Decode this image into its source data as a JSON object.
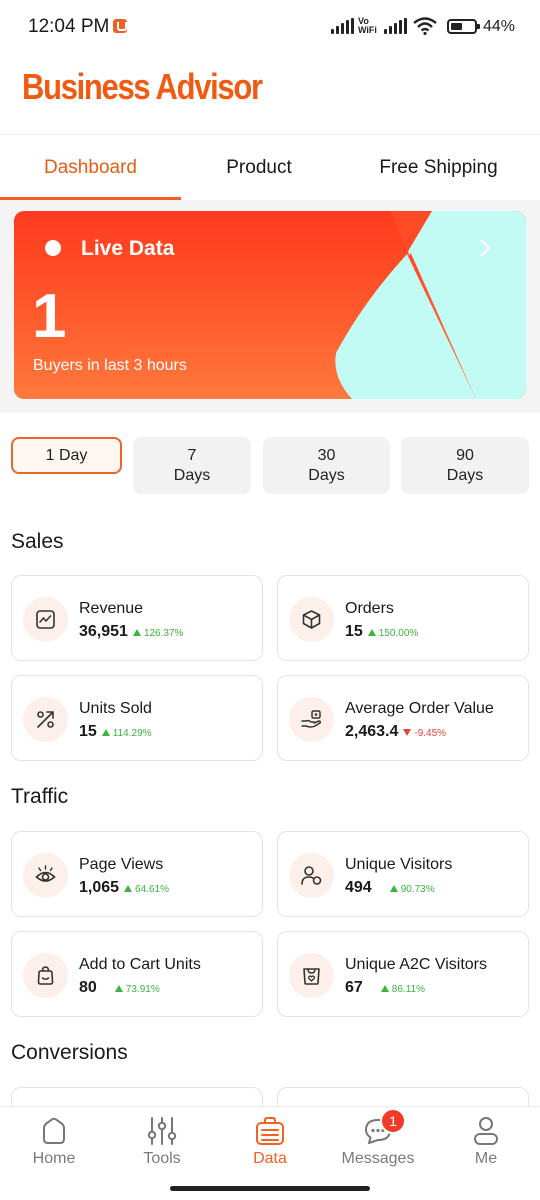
{
  "status_bar": {
    "time": "12:04 PM",
    "vo": "Vo",
    "wifi_label": "WiFi",
    "battery": "44%"
  },
  "header": {
    "title": "Business Advisor"
  },
  "tabs": [
    {
      "label": "Dashboard",
      "active": true
    },
    {
      "label": "Product",
      "active": false
    },
    {
      "label": "Free Shipping",
      "active": false
    }
  ],
  "live": {
    "title": "Live Data",
    "count": "1",
    "subtitle": "Buyers in last 3 hours"
  },
  "periods": [
    {
      "label": "1 Day",
      "active": true
    },
    {
      "label": "7\nDays",
      "active": false
    },
    {
      "label": "30\nDays",
      "active": false
    },
    {
      "label": "90\nDays",
      "active": false
    }
  ],
  "sales": {
    "title": "Sales",
    "metrics": [
      {
        "label": "Revenue",
        "value": "36,951",
        "change": "126.37%",
        "direction": "up",
        "icon": "trend-chart-icon"
      },
      {
        "label": "Orders",
        "value": "15",
        "change": "150.00%",
        "direction": "up",
        "icon": "box-icon"
      },
      {
        "label": "Units Sold",
        "value": "15",
        "change": "114.29%",
        "direction": "up",
        "icon": "percent-icon"
      },
      {
        "label": "Average Order Value",
        "value": "2,463.4",
        "change": "-9.45%",
        "direction": "down",
        "icon": "hand-money-icon"
      }
    ]
  },
  "traffic": {
    "title": "Traffic",
    "metrics": [
      {
        "label": "Page Views",
        "value": "1,065",
        "change": "64.61%",
        "direction": "up",
        "icon": "eye-icon"
      },
      {
        "label": "Unique Visitors",
        "value": "494",
        "change": "90.73%",
        "direction": "up",
        "icon": "users-icon"
      },
      {
        "label": "Add to Cart Units",
        "value": "80",
        "change": "73.91%",
        "direction": "up",
        "icon": "bag-icon"
      },
      {
        "label": "Unique A2C Visitors",
        "value": "67",
        "change": "86.11%",
        "direction": "up",
        "icon": "bag-heart-icon"
      }
    ]
  },
  "conversions": {
    "title": "Conversions"
  },
  "bottom_nav": {
    "items": [
      {
        "label": "Home",
        "icon": "home-icon"
      },
      {
        "label": "Tools",
        "icon": "sliders-icon"
      },
      {
        "label": "Data",
        "icon": "data-icon",
        "active": true
      },
      {
        "label": "Messages",
        "icon": "chat-icon"
      },
      {
        "label": "Me",
        "icon": "person-icon"
      }
    ],
    "messages_badge": "1"
  },
  "colors": {
    "brand": "#f05a12",
    "accent": "#f06224",
    "positive": "#3cb43c",
    "negative": "#e8403a"
  }
}
